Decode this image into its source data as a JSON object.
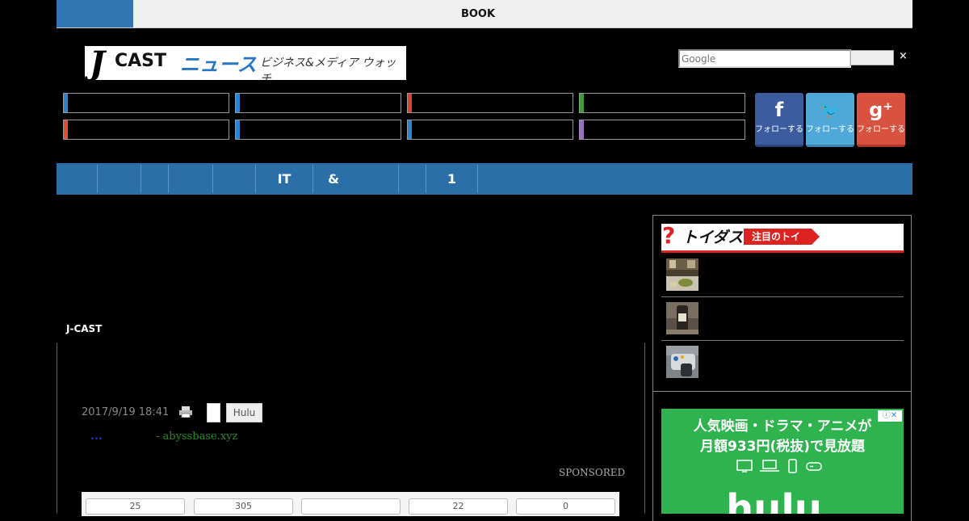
{
  "topbar": {
    "book_label": "BOOK"
  },
  "logo": {
    "j": "J",
    "cast": "CAST",
    "news": "ニュース",
    "tagline": "ビジネス&メディア ウォッチ"
  },
  "search": {
    "placeholder": "Google",
    "close": "×"
  },
  "categories": [
    {
      "color": "#2a84d2"
    },
    {
      "color": "#2a84d2"
    },
    {
      "color": "#d9432f"
    },
    {
      "color": "#3f9a3a"
    },
    {
      "color": "#e24f2e"
    },
    {
      "color": "#2a84d2"
    },
    {
      "color": "#2a84d2"
    },
    {
      "color": "#9b6fc0"
    }
  ],
  "social": [
    {
      "name": "facebook",
      "icon": "f",
      "label": "フォローする",
      "color": "#3b5c9e"
    },
    {
      "name": "twitter",
      "icon": "🐦",
      "label": "フォローする",
      "color": "#4fa8d8"
    },
    {
      "name": "google-plus",
      "icon": "g⁺",
      "label": "フォローする",
      "color": "#d9523f"
    }
  ],
  "nav": [
    "",
    "",
    "",
    "",
    "",
    "IT",
    "&",
    "",
    "1",
    ""
  ],
  "main": {
    "section_label": "J-CAST",
    "date": "2017/9/19 18:41",
    "tag_hulu": "Hulu",
    "ad_dots": "...",
    "ad_source": "- abyssbase.xyz",
    "sponsored": "SPONSORED",
    "share_counts": [
      "25",
      "305",
      "",
      "22",
      "0"
    ]
  },
  "sidebar": {
    "toigazu_title": "トイダス",
    "toigazu_badge": "注目のトイ"
  },
  "hulu_ad": {
    "line1": "人気映画・ドラマ・アニメが",
    "line2": "月額933円(税抜)で見放題",
    "adchoice": "ⓘ✕",
    "logo": "hulu"
  },
  "colors": {
    "nav_blue": "#2a6fa8",
    "hulu_green": "#2eb34f"
  }
}
